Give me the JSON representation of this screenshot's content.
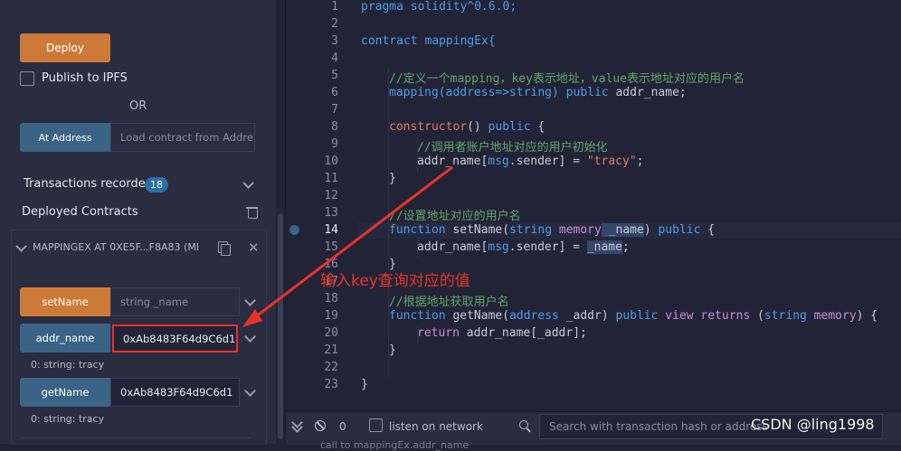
{
  "left_panel": {
    "deploy_label": "Deploy",
    "publish_label": "Publish to IPFS",
    "or_label": "OR",
    "at_address_label": "At Address",
    "load_contract_placeholder": "Load contract from Addre",
    "transactions_label": "Transactions recorded",
    "transactions_count": "18",
    "deployed_contracts_label": "Deployed Contracts",
    "contract_instance": "MAPPINGEX AT 0XE5F...F8A83 (MI",
    "functions": [
      {
        "label": "setName",
        "placeholder": "string _name",
        "value": ""
      },
      {
        "label": "addr_name",
        "placeholder": "",
        "value": "0xAb8483F64d9C6d1"
      },
      {
        "label": "getName",
        "placeholder": "",
        "value": "0xAb8483F64d9C6d1"
      }
    ],
    "result_addr_name": "0: string: tracy",
    "result_get_name": "0: string: tracy"
  },
  "annotation": {
    "text": "输入key查询对应的值",
    "color": "#e8322a"
  },
  "editor": {
    "line_numbers": [
      "1",
      "2",
      "3",
      "4",
      "5",
      "6",
      "7",
      "8",
      "9",
      "10",
      "11",
      "12",
      "13",
      "14",
      "15",
      "16",
      "17",
      "18",
      "19",
      "20",
      "21",
      "22",
      "23"
    ],
    "lines": {
      "l1": "pragma solidity^0.6.0;",
      "l3": "contract mappingEx{",
      "l5": "//定义一个mapping，key表示地址，value表示地址对应的用户名",
      "l6a": "mapping(address=>string) ",
      "l6b": "public",
      "l6c": " addr_name;",
      "l8a": "constructor",
      "l8b": "() ",
      "l8c": "public",
      "l8d": " {",
      "l9": "//调用者账户地址对应的用户初始化",
      "l10a": "addr_name[",
      "l10b": "msg",
      "l10c": ".sender] = ",
      "l10d": "\"tracy\"",
      "l10e": ";",
      "l11": "}",
      "l13": "//设置地址对应的用户名",
      "l14a": "function",
      "l14b": " setName(",
      "l14c": "string",
      "l14d": " memory",
      "l14e": " _name",
      "l14f": ") ",
      "l14g": "public",
      "l14h": " {",
      "l15a": "addr_name[",
      "l15b": "msg",
      "l15c": ".sender] = ",
      "l15d": "_name",
      "l15e": ";",
      "l16": "}",
      "l18": "//根据地址获取用户名",
      "l19a": "function",
      "l19b": " getName(",
      "l19c": "address",
      "l19d": " _addr) ",
      "l19e": "public",
      "l19f": " view",
      "l19g": " returns",
      "l19h": " (",
      "l19i": "string",
      "l19j": " memory",
      "l19k": ") {",
      "l20a": "return",
      "l20b": " addr_name[_addr];",
      "l21": "}",
      "l23": "}"
    }
  },
  "bottom_bar": {
    "pending_count": "0",
    "listen_label": "listen on network",
    "search_placeholder": "Search with transaction hash or address",
    "watermark": "CSDN @ling1998",
    "footer_partial": "call to mappingEx.addr_name"
  },
  "colors": {
    "accent_orange": "#cd7a38",
    "accent_blue": "#3b6386",
    "badge": "#2a6fa8"
  }
}
